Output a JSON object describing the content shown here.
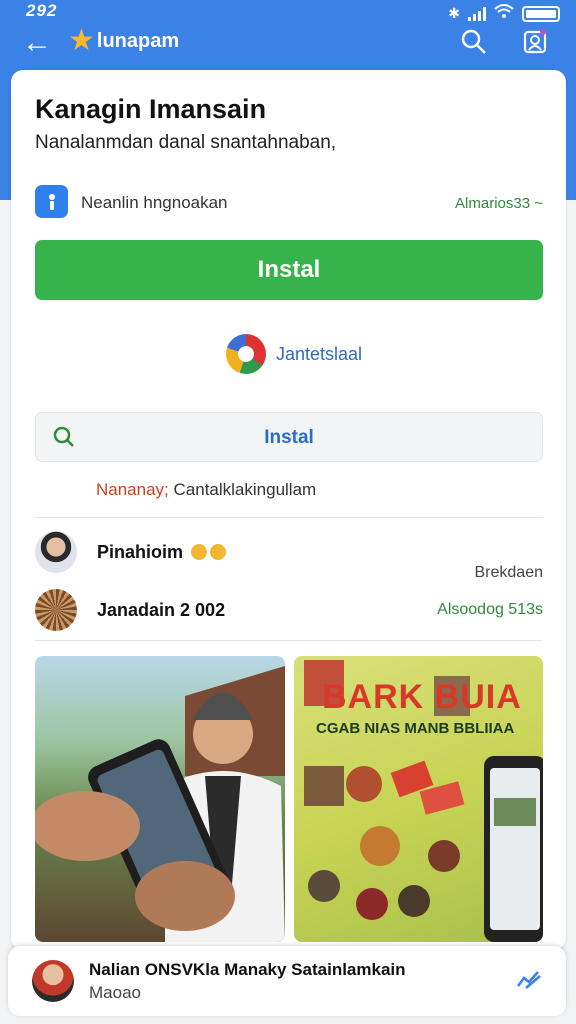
{
  "status": {
    "time": "292"
  },
  "header": {
    "title": "lunapam",
    "subtitle": "",
    "accent": "#3b82e6"
  },
  "main": {
    "title": "Kanagin Imansain",
    "subtitle": "Nanalanmdan danal snantahnaban,",
    "permission_label": "Neanlin hngnoakan",
    "permission_right": "Almarios33 ~",
    "install_label": "Instal",
    "brand_name": "Jantetslaal",
    "search_label": "Instal",
    "note_prefix": "Nananay;",
    "note_text": "Cantalklakingullam",
    "users": [
      {
        "name": "Pinahioim",
        "right": "Brekdaen"
      },
      {
        "name": "Janadain 2 002",
        "right": "Alsoodog 513s"
      }
    ],
    "photo2_text": {
      "top": "BARK BUIA",
      "caption": "CGAB NIAS MANB BBLIIAA"
    }
  },
  "bottom": {
    "title": "Nalian ONSVKla Manaky Satainlamkain",
    "subtitle": "Maoao"
  },
  "colors": {
    "install": "#36b34a",
    "link": "#2b6cc8",
    "green_text": "#2e8b3a"
  }
}
